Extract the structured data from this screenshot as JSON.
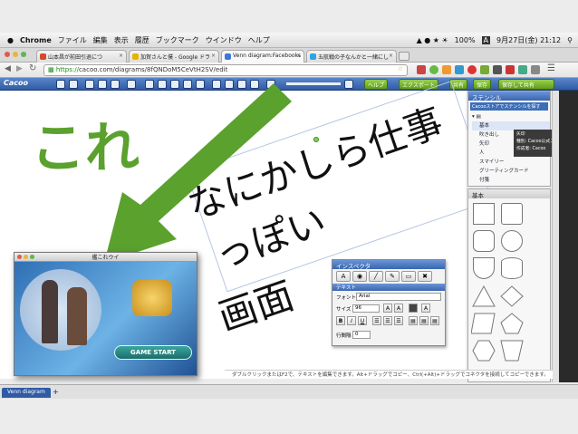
{
  "menubar": {
    "apple": "",
    "app": "Chrome",
    "items": [
      "ファイル",
      "編集",
      "表示",
      "履歴",
      "ブックマーク",
      "ウインドウ",
      "ヘルプ"
    ],
    "battery": "100%",
    "input_method": "A",
    "datetime": "9月27日(金) 21:12"
  },
  "tabs": [
    {
      "label": "山本昌が前田引退につ",
      "color": "#d24b2a"
    },
    {
      "label": "加賀さんと僕 - Google ドラ",
      "color": "#e6b400"
    },
    {
      "label": "Venn diagram:Facebooks",
      "color": "#3c78d8"
    },
    {
      "label": "五航戦の子なんかと一緒にし",
      "color": "#2fa3e6"
    }
  ],
  "address": {
    "scheme": "https://",
    "rest": "cacoo.com/diagrams/8fQNDoM5CeVtH2SV/edit"
  },
  "toolbar": {
    "logo": "Cacoo",
    "help": "ヘルプ",
    "export": "エクスポート",
    "share": "共有",
    "save": "保存",
    "save_as": "保存して共有"
  },
  "stencil": {
    "title": "ステンシル",
    "store_link": "Cacooストアでステンシルを探す",
    "items": [
      "基本",
      "吹き出し",
      "矢印",
      "人",
      "スマイリー",
      "グリーティングカード",
      "付箋"
    ],
    "tooltip_title": "矢印",
    "tooltip_type": "種別: Cacoo公式ステンシル",
    "tooltip_author": "作成者: Cacoo",
    "palette_title": "基本"
  },
  "inspector": {
    "title": "インスペクタ",
    "section": "テキスト",
    "font_label": "フォント",
    "font_value": "Arial",
    "size_label": "サイズ",
    "size_value": "96",
    "line_label": "行間隔",
    "line_value": "0",
    "bold": "B",
    "italic": "I",
    "underline": "U",
    "text_a": "A"
  },
  "canvas_text": {
    "line1": "なにかしら仕事",
    "line2": "っぽい",
    "line3": "画面"
  },
  "overlay": {
    "label": "これ",
    "arrow_color": "#5aa12e"
  },
  "game_window": {
    "title": "艦これウイ",
    "start": "GAME START"
  },
  "status": {
    "hint": "ダブルクリックまたはF2で、テキストを編集できます。Alt+ドラッグでコピー、Ctrl(+Alt)+ドラッグでコネクタを接続してコピーできます。",
    "sheet_tab": "Venn diagram",
    "add_sheet": "+"
  }
}
